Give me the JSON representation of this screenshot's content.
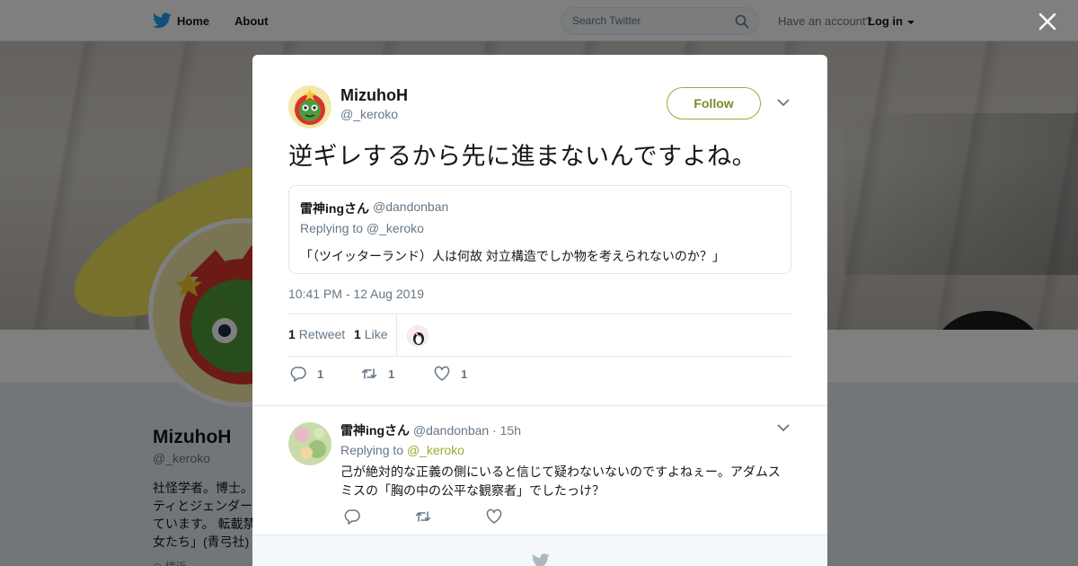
{
  "nav": {
    "home": "Home",
    "about": "About",
    "search_placeholder": "Search Twitter",
    "account_prompt": "Have an account?",
    "login": "Log in"
  },
  "profile": {
    "name": "MizuhoH",
    "handle": "@_keroko",
    "bio": "社怪学者。博士。ティとジェンダーています。 転載禁女たち」(青弓社)エ",
    "extra": "◎ 横浜"
  },
  "tweet": {
    "name": "MizuhoH",
    "handle": "@_keroko",
    "follow_label": "Follow",
    "text": "逆ギレするから先に進まないんですよね。",
    "quote": {
      "name": "雷神ingさん",
      "handle": "@dandonban",
      "replying": "Replying to @_keroko",
      "text": "「（ツイッターランド）人は何故 対立構造でしか物を考えられないのか？」"
    },
    "timestamp": "10:41 PM - 12 Aug 2019",
    "stats": {
      "retweet_count": "1",
      "retweet_label": "Retweet",
      "like_count": "1",
      "like_label": "Like"
    },
    "actions": {
      "reply_count": "1",
      "retweet_count": "1",
      "like_count": "1"
    }
  },
  "reply": {
    "name": "雷神ingさん",
    "meta": "@dandonban · 15h",
    "replying_prefix": "Replying to ",
    "replying_handle": "@_keroko",
    "text": "己が絶対的な正義の側にいると信じて疑わないないのですよねぇー。アダムスミスの「胸の中の公平な観察者」でしたっけ？"
  },
  "colors": {
    "accent": "#9aab37",
    "link": "#9aab37",
    "muted": "#657786",
    "twitter_blue": "#1da1f2"
  }
}
